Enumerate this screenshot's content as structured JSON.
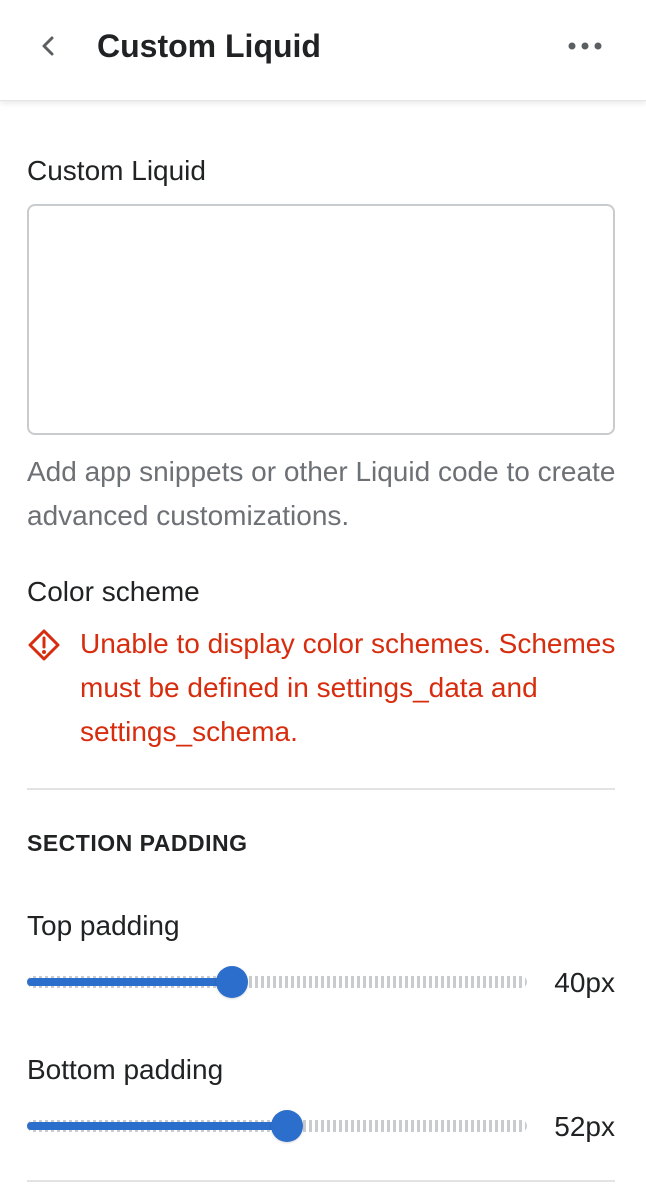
{
  "header": {
    "title": "Custom Liquid"
  },
  "custom_liquid": {
    "label": "Custom Liquid",
    "value": "",
    "help_text": "Add app snippets or other Liquid code to create advanced customizations."
  },
  "color_scheme": {
    "label": "Color scheme",
    "error_text": "Unable to display color schemes. Schemes must be defined in settings_data and settings_schema."
  },
  "section_padding": {
    "heading": "SECTION PADDING",
    "top": {
      "label": "Top padding",
      "value_text": "40px",
      "value": 40,
      "fill_fraction": 0.41
    },
    "bottom": {
      "label": "Bottom padding",
      "value_text": "52px",
      "value": 52,
      "fill_fraction": 0.52
    }
  },
  "colors": {
    "accent": "#2c6ecb",
    "error": "#d72c0d",
    "text": "#202223",
    "subdued": "#6d7175"
  },
  "icons": {
    "back": "chevron-left-icon",
    "more": "horizontal-dots-icon",
    "error": "diamond-alert-icon"
  }
}
